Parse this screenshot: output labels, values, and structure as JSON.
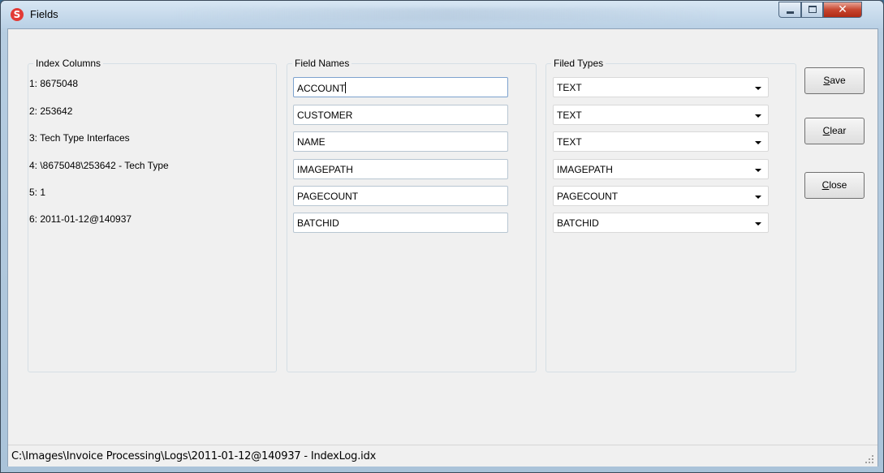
{
  "window": {
    "title": "Fields"
  },
  "index_columns": {
    "label": "Index Columns",
    "items": [
      "1: 8675048",
      "2: 253642",
      "3: Tech Type Interfaces",
      "4: \\8675048\\253642 - Tech Type",
      "5: 1",
      "6: 2011-01-12@140937"
    ]
  },
  "field_names": {
    "label": "Field Names",
    "values": [
      "ACCOUNT",
      "CUSTOMER",
      "NAME",
      "IMAGEPATH",
      "PAGECOUNT",
      "BATCHID"
    ]
  },
  "field_types": {
    "label": "Filed Types",
    "values": [
      "TEXT",
      "TEXT",
      "TEXT",
      "IMAGEPATH",
      "PAGECOUNT",
      "BATCHID"
    ]
  },
  "buttons": {
    "save": {
      "accel": "S",
      "rest": "ave"
    },
    "clear": {
      "accel": "C",
      "rest": "lear"
    },
    "close": {
      "accel": "C",
      "rest": "lose"
    }
  },
  "status": {
    "path": "C:\\Images\\Invoice Processing\\Logs\\2011-01-12@140937 - IndexLog.idx"
  }
}
